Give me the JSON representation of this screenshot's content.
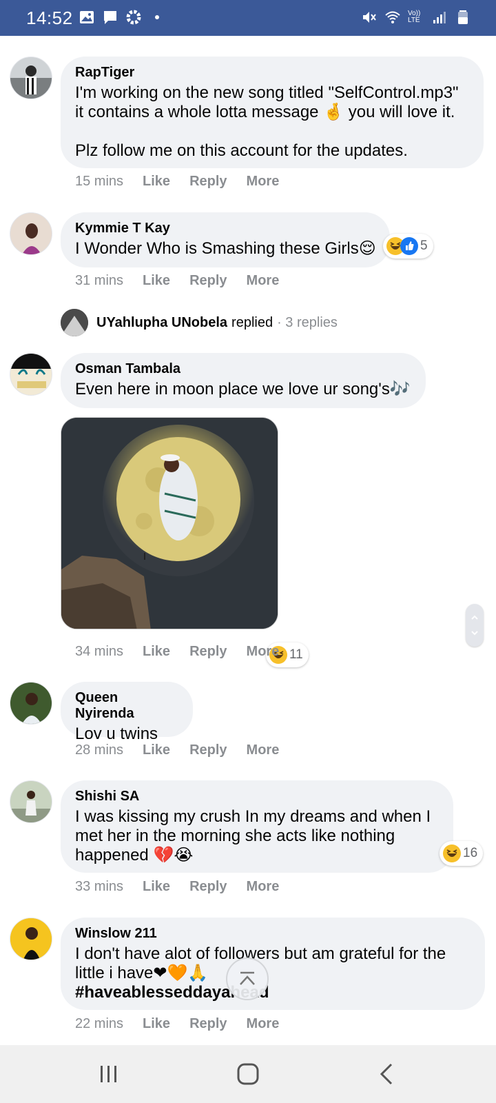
{
  "status_bar": {
    "time": "14:52",
    "left_icons": [
      "image-icon",
      "message-icon",
      "settings-icon",
      "dot-icon"
    ],
    "right_icons": [
      "mute-icon",
      "wifi-icon",
      "volte-icon",
      "signal-icon",
      "battery-icon"
    ],
    "volte_label": "Vo)) LTE",
    "bg_color": "#3b5998"
  },
  "comments": [
    {
      "author": "RapTiger",
      "text": "I'm working on the new song titled \"SelfControl.mp3\" it contains a whole lotta message 🤞 you will love it.\n\nPlz follow me on this account for the updates.",
      "time": "15 mins",
      "like": "Like",
      "reply": "Reply",
      "more": "More"
    },
    {
      "author": "Kymmie T Kay",
      "text": "I Wonder Who is Smashing these Girls😌",
      "time": "31 mins",
      "like": "Like",
      "reply": "Reply",
      "more": "More",
      "reaction_count": "5",
      "reaction_icons": [
        "laugh-icon",
        "like-icon"
      ]
    },
    {
      "author": "Osman Tambala",
      "text": "Even here in moon place we love ur song's🎶",
      "time": "34 mins",
      "like": "Like",
      "reply": "Reply",
      "more": "More",
      "reaction_count": "11",
      "reaction_icons": [
        "laugh-icon"
      ]
    },
    {
      "author": "Queen Nyirenda",
      "text": "Lov u twins",
      "time": "28 mins",
      "like": "Like",
      "reply": "Reply",
      "more": "More"
    },
    {
      "author": "Shishi SA",
      "text": "I was kissing my crush In my dreams and when I met her in the morning she acts like nothing happened 💔😭",
      "time": "33 mins",
      "like": "Like",
      "reply": "Reply",
      "more": "More",
      "reaction_count": "16",
      "reaction_icons": [
        "laugh-icon"
      ]
    },
    {
      "author": "Winslow 211",
      "text": "I don't have alot of followers but am grateful for the little i have❤🧡🙏",
      "hashtag": "#haveablesseddayahead",
      "time": "22 mins",
      "like": "Like",
      "reply": "Reply",
      "more": "More"
    }
  ],
  "replied": {
    "name": "UYahlupha UNobela",
    "verb": "replied",
    "count": "· 3 replies"
  },
  "nav_bar": {
    "buttons": [
      "recent-apps-icon",
      "home-icon",
      "back-icon"
    ]
  }
}
